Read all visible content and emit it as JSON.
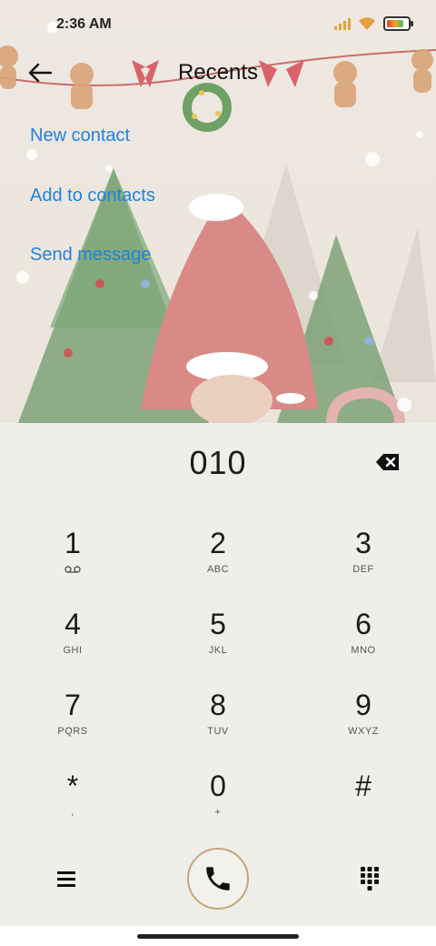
{
  "status_bar": {
    "time": "2:36 AM"
  },
  "header": {
    "title": "Recents"
  },
  "menu": {
    "new_contact": "New contact",
    "add_to_contacts": "Add to contacts",
    "send_message": "Send message"
  },
  "dialer": {
    "number": "010",
    "keys": [
      {
        "digit": "1",
        "letters": ""
      },
      {
        "digit": "2",
        "letters": "ABC"
      },
      {
        "digit": "3",
        "letters": "DEF"
      },
      {
        "digit": "4",
        "letters": "GHI"
      },
      {
        "digit": "5",
        "letters": "JKL"
      },
      {
        "digit": "6",
        "letters": "MNO"
      },
      {
        "digit": "7",
        "letters": "PQRS"
      },
      {
        "digit": "8",
        "letters": "TUV"
      },
      {
        "digit": "9",
        "letters": "WXYZ"
      },
      {
        "digit": "*",
        "letters": ","
      },
      {
        "digit": "0",
        "letters": "+"
      },
      {
        "digit": "#",
        "letters": ""
      }
    ]
  },
  "colors": {
    "accent": "#1e82e2",
    "call_ring": "#c6a57d",
    "background": "#efeee9"
  },
  "icons": {
    "back": "arrow-left-icon",
    "backspace": "backspace-icon",
    "voicemail": "voicemail-icon",
    "menu": "hamburger-menu-icon",
    "call": "phone-icon",
    "keypad": "dialpad-icon"
  }
}
